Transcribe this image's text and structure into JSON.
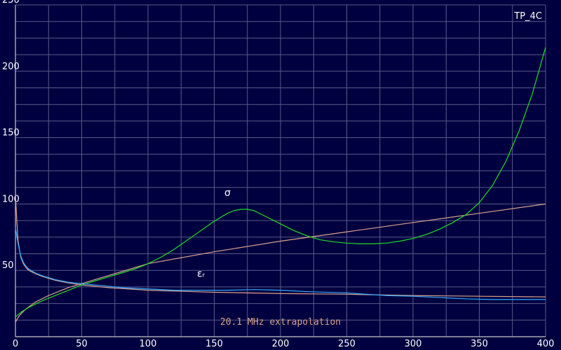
{
  "chart_data": {
    "type": "line",
    "badge": "TP_4C",
    "annotation": "20.1 MHz extrapolation",
    "xlim": [
      0,
      400
    ],
    "ylim": [
      0,
      250
    ],
    "x_ticks": [
      0,
      50,
      100,
      150,
      200,
      250,
      300,
      350,
      400
    ],
    "y_ticks": [
      50,
      100,
      150,
      200,
      250
    ],
    "grid": true,
    "colors": {
      "background": "#000040",
      "grid": "#5a5a8a",
      "axis": "#c8c8c8",
      "text": "#ffffff",
      "annotation": "#d9a38a",
      "sigma": "#22dd22",
      "sigma_extrapolation": "#d9a38a",
      "epsilon": "#33aaff",
      "epsilon_extrapolation": "#d9a38a"
    },
    "series": [
      {
        "name": "σ",
        "label_at": [
          160,
          106
        ],
        "color": "#22dd22",
        "x": [
          0,
          5,
          10,
          20,
          30,
          40,
          50,
          60,
          70,
          80,
          90,
          100,
          110,
          120,
          130,
          140,
          150,
          160,
          165,
          170,
          175,
          180,
          190,
          200,
          210,
          220,
          230,
          240,
          250,
          260,
          270,
          280,
          290,
          300,
          310,
          320,
          330,
          340,
          350,
          360,
          370,
          380,
          390,
          400
        ],
        "values": [
          15,
          19,
          22,
          27,
          31,
          35,
          39,
          42,
          45,
          48,
          51,
          55,
          60,
          66,
          73,
          80,
          87,
          93,
          95,
          96,
          96,
          95,
          90,
          85,
          80,
          76,
          73,
          71.5,
          70.5,
          70,
          70,
          70.5,
          72,
          74,
          77,
          81,
          86,
          92,
          101,
          114,
          132,
          155,
          183,
          218
        ]
      },
      {
        "name": "σ extrapolation",
        "color": "#d9a38a",
        "x": [
          0,
          3,
          8,
          15,
          25,
          40,
          60,
          80,
          100,
          150,
          200,
          250,
          300,
          350,
          400
        ],
        "values": [
          11,
          16,
          21,
          26,
          31,
          37,
          43,
          49,
          55,
          64,
          72,
          79,
          86,
          93,
          100
        ]
      },
      {
        "name": "εᵣ",
        "label_at": [
          140,
          45
        ],
        "color": "#33aaff",
        "x": [
          0,
          2,
          4,
          6,
          8,
          10,
          15,
          20,
          30,
          40,
          50,
          60,
          70,
          80,
          100,
          120,
          140,
          160,
          180,
          200,
          220,
          250,
          280,
          300,
          320,
          340,
          360,
          380,
          400
        ],
        "values": [
          82,
          70,
          61,
          56,
          53,
          51,
          48,
          46,
          43,
          41,
          40,
          39,
          38,
          37,
          36,
          35,
          35,
          35,
          35.5,
          35,
          34,
          33,
          31,
          30.5,
          29.5,
          28.5,
          28,
          28,
          28
        ]
      },
      {
        "name": "εᵣ extrapolation",
        "color": "#d9a38a",
        "x": [
          0,
          1,
          2,
          4,
          6,
          8,
          10,
          15,
          20,
          30,
          40,
          50,
          70,
          100,
          150,
          200,
          250,
          300,
          350,
          400
        ],
        "values": [
          107,
          88,
          72,
          60,
          55,
          52,
          50,
          47.5,
          45.5,
          42.5,
          40.5,
          39,
          37,
          35,
          33.5,
          32.5,
          32,
          31,
          30.5,
          30
        ]
      }
    ]
  }
}
